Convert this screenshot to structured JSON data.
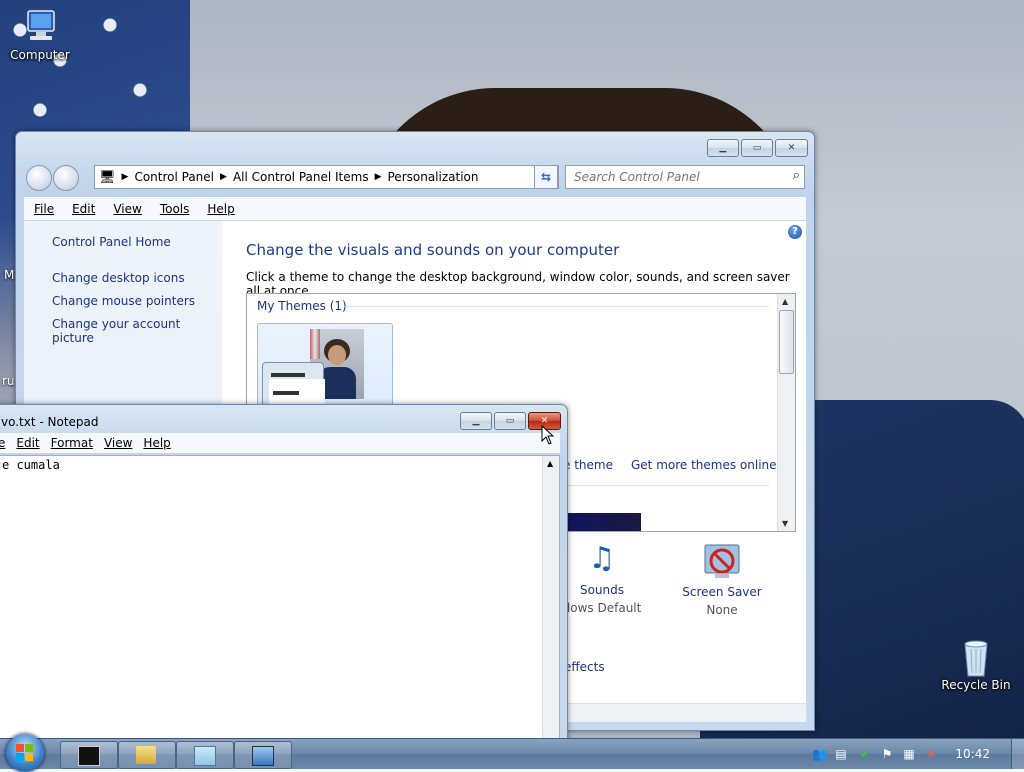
{
  "desktop": {
    "icons": {
      "computer": "Computer",
      "recycle_bin": "Recycle Bin",
      "partial_left_1": "M",
      "partial_left_2": "ru"
    }
  },
  "control_panel": {
    "breadcrumb": [
      "Control Panel",
      "All Control Panel Items",
      "Personalization"
    ],
    "search_placeholder": "Search Control Panel",
    "menu": [
      "File",
      "Edit",
      "View",
      "Tools",
      "Help"
    ],
    "left_nav": {
      "home": "Control Panel Home",
      "links": [
        "Change desktop icons",
        "Change mouse pointers",
        "Change your account picture"
      ]
    },
    "heading": "Change the visuals and sounds on your computer",
    "subheading": "Click a theme to change the desktop background, window color, sounds, and screen saver all at once.",
    "my_themes_label": "My Themes (1)",
    "save_theme_partial": "e theme",
    "get_more_themes": "Get more themes online",
    "sounds": {
      "name": "Sounds",
      "value_partial": "dows Default"
    },
    "screen_saver": {
      "name": "Screen Saver",
      "value": "None"
    },
    "effects_partial": "effects"
  },
  "notepad": {
    "title_partial": "vo.txt - Notepad",
    "menu": [
      "e",
      "Edit",
      "Format",
      "View",
      "Help"
    ],
    "content_partial": "e cumala"
  },
  "taskbar": {
    "clock": "10:42"
  },
  "colors": {
    "link": "#1e3287",
    "heading": "#1e3b8a",
    "close_hot": "#c8442a",
    "taskbar": "#6a86a9"
  }
}
